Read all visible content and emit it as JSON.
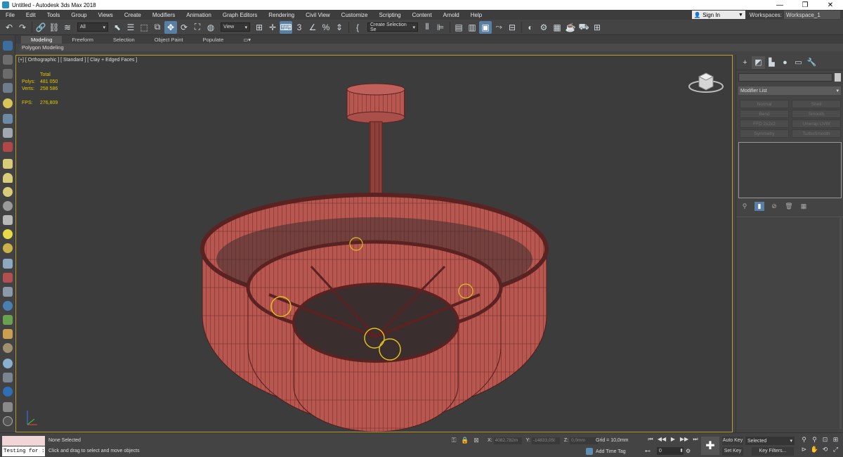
{
  "window": {
    "title": "Untitled - Autodesk 3ds Max 2018",
    "minimize": "—",
    "maximize": "❐",
    "close": "✕"
  },
  "menu": {
    "items": [
      "File",
      "Edit",
      "Tools",
      "Group",
      "Views",
      "Create",
      "Modifiers",
      "Animation",
      "Graph Editors",
      "Rendering",
      "Civil View",
      "Customize",
      "Scripting",
      "Content",
      "Arnold",
      "Help"
    ],
    "sign_in": "Sign In",
    "workspaces_label": "Workspaces:",
    "workspace_value": "Workspace_1"
  },
  "toolbar": {
    "selection_filter": "All",
    "ref_coord": "View",
    "named_selection": "Create Selection Se"
  },
  "ribbon": {
    "tabs": [
      "Modeling",
      "Freeform",
      "Selection",
      "Object Paint",
      "Populate"
    ],
    "active_tab": "Modeling",
    "sub_label": "Polygon Modeling"
  },
  "viewport": {
    "label": "[+] [ Orthographic ] [ Standard ] [ Clay + Edged Faces ]",
    "stats": {
      "total_label": "Total",
      "polys_label": "Polys:",
      "polys_value": "481 050",
      "verts_label": "Verts:",
      "verts_value": "258 586",
      "fps_label": "FPS:",
      "fps_value": "276,809"
    },
    "accent_color": "#bda12e",
    "mesh_color": "#b65049"
  },
  "command_panel": {
    "modifier_list": "Modifier List",
    "modifier_buttons": [
      "Normal",
      "Shell",
      "Bend",
      "Smooth",
      "FFD 2x2x2",
      "Unwrap UVW",
      "Symmetry",
      "TurboSmooth"
    ]
  },
  "status": {
    "script_text": "Testing for :",
    "selection": "None Selected",
    "prompt": "Click and drag to select and move objects",
    "x_label": "X:",
    "x_value": "4082,782m",
    "y_label": "Y:",
    "y_value": "-14833,05t",
    "z_label": "Z:",
    "z_value": "0,0mm",
    "grid": "Grid = 10,0mm",
    "add_time_tag": "Add Time Tag",
    "frame": "0",
    "auto_key": "Auto Key",
    "set_key": "Set Key",
    "selected_dd": "Selected",
    "key_filters": "Key Filters..."
  }
}
